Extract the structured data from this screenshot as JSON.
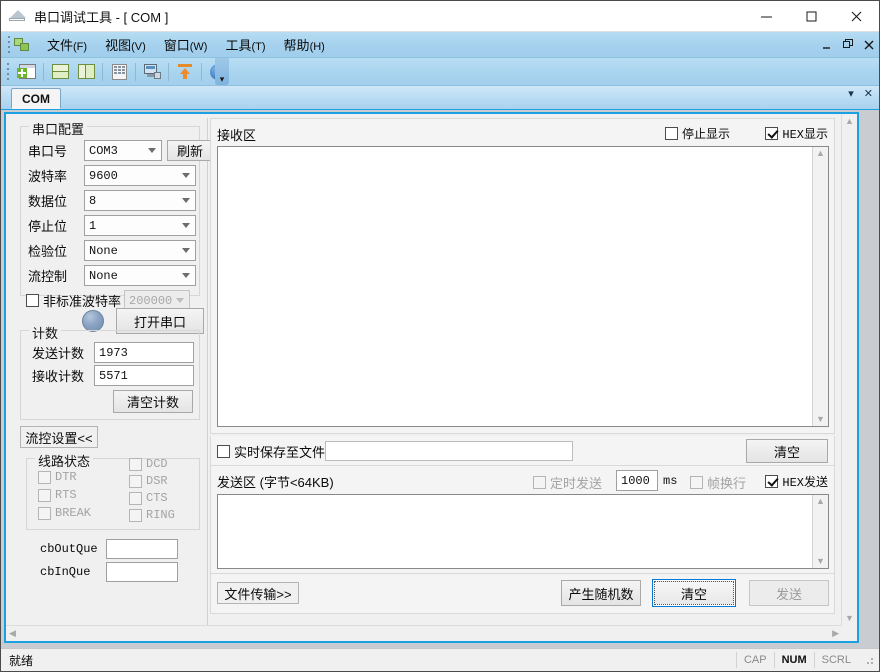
{
  "window": {
    "title": "串口调试工具 - [ COM ]",
    "minimize": "–",
    "maximize": "☐",
    "close": "✕"
  },
  "mdi_controls": {
    "minimize": "–",
    "restore": "❐",
    "close": "✕"
  },
  "menu": {
    "items": [
      {
        "label": "文件",
        "mnemonic": "(F)"
      },
      {
        "label": "视图",
        "mnemonic": "(V)"
      },
      {
        "label": "窗口",
        "mnemonic": "(W)"
      },
      {
        "label": "工具",
        "mnemonic": "(T)"
      },
      {
        "label": "帮助",
        "mnemonic": "(H)"
      }
    ]
  },
  "toolbar": {
    "buttons": [
      "new-window-icon",
      "tile-horizontal-icon",
      "tile-vertical-icon",
      "calculator-icon",
      "monitor-icon",
      "upload-icon",
      "help-icon"
    ],
    "overflow": "▾"
  },
  "tabs": {
    "items": [
      {
        "label": "COM",
        "active": true
      }
    ],
    "dropdown": "▾",
    "close": "✕"
  },
  "serial_config": {
    "group_label": "串口配置",
    "port": {
      "label": "串口号",
      "value": "COM3"
    },
    "refresh_button": "刷新",
    "baud": {
      "label": "波特率",
      "value": "9600"
    },
    "data_bits": {
      "label": "数据位",
      "value": "8"
    },
    "stop_bits": {
      "label": "停止位",
      "value": "1"
    },
    "parity": {
      "label": "检验位",
      "value": "None"
    },
    "flow_control": {
      "label": "流控制",
      "value": "None"
    },
    "nonstandard_baud": {
      "label": "非标准波特率",
      "checked": false,
      "value": "200000"
    },
    "open_button": "打开串口",
    "led_state": "off"
  },
  "counter": {
    "group_label": "计数",
    "tx": {
      "label": "发送计数",
      "value": "1973"
    },
    "rx": {
      "label": "接收计数",
      "value": "5571"
    },
    "clear_button": "清空计数"
  },
  "flow_settings": {
    "toggle_button": "流控设置<<",
    "line_state": {
      "group_label": "线路状态",
      "left": [
        {
          "label": "DTR",
          "checked": false,
          "disabled": true
        },
        {
          "label": "RTS",
          "checked": false,
          "disabled": true
        },
        {
          "label": "BREAK",
          "checked": false,
          "disabled": true
        }
      ],
      "right": [
        {
          "label": "DCD",
          "checked": false,
          "disabled": true
        },
        {
          "label": "DSR",
          "checked": false,
          "disabled": true
        },
        {
          "label": "CTS",
          "checked": false,
          "disabled": true
        },
        {
          "label": "RING",
          "checked": false,
          "disabled": true
        }
      ]
    },
    "queues": [
      {
        "label": "cbOutQue",
        "value": ""
      },
      {
        "label": "cbInQue",
        "value": ""
      }
    ]
  },
  "receive_area": {
    "title": "接收区",
    "stop_display": {
      "label": "停止显示",
      "checked": false
    },
    "hex_display": {
      "label": "HEX显示",
      "checked": true
    },
    "content": ""
  },
  "save_row": {
    "checkbox": {
      "label": "实时保存至文件",
      "checked": false
    },
    "path_value": "",
    "clear_button": "清空"
  },
  "send_area": {
    "title": "发送区 (字节<64KB)",
    "timed_send": {
      "label": "定时发送",
      "checked": false,
      "disabled": true
    },
    "interval_value": "1000",
    "interval_unit": "ms",
    "frame_newline": {
      "label": "帧换行",
      "checked": false,
      "disabled": true
    },
    "hex_send": {
      "label": "HEX发送",
      "checked": true
    },
    "content": ""
  },
  "bottom_buttons": {
    "file_transfer": "文件传输>>",
    "random": "产生随机数",
    "clear": "清空",
    "send": "发送",
    "send_disabled": true
  },
  "statusbar": {
    "message": "就绪",
    "indicators": [
      {
        "label": "CAP",
        "active": false
      },
      {
        "label": "NUM",
        "active": true
      },
      {
        "label": "SCRL",
        "active": false
      }
    ]
  },
  "colors": {
    "accent": "#1ba1e2",
    "menu_blue": "#a9d2ef",
    "panel": "#f0f0f0",
    "default_button_border": "#0078d7"
  }
}
